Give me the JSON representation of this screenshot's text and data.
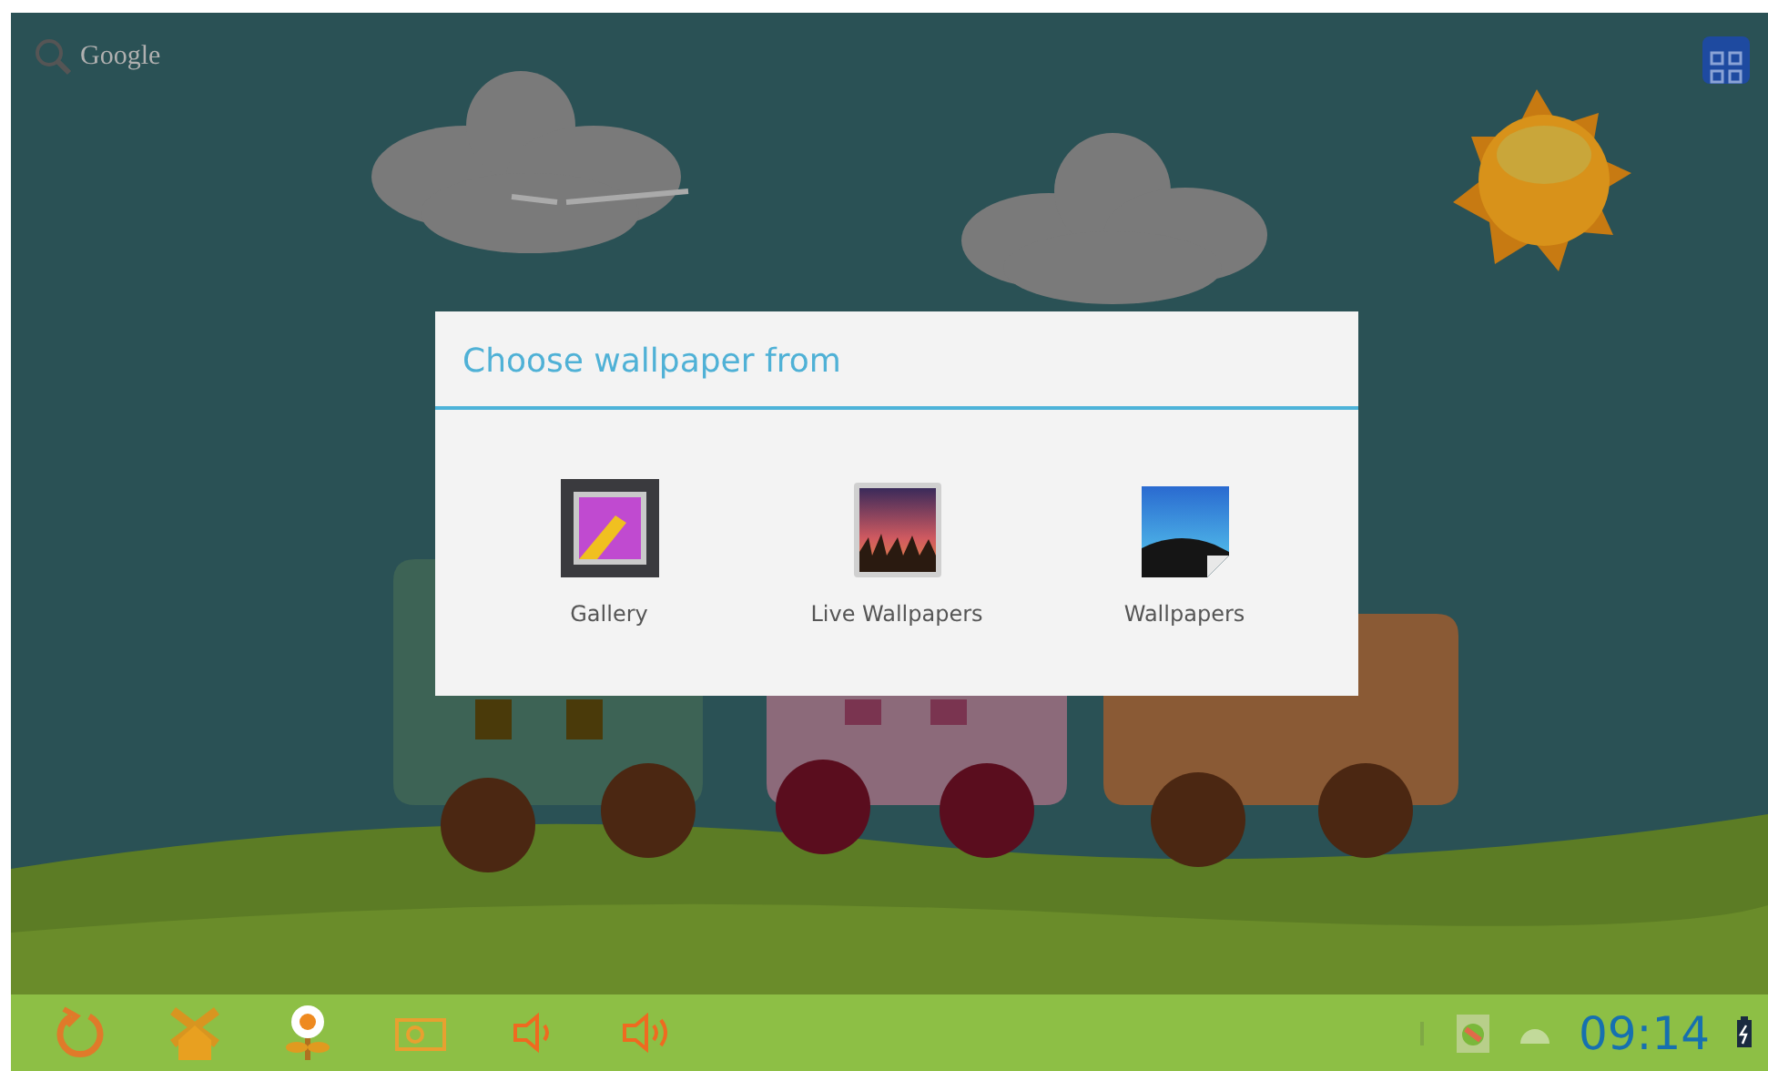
{
  "search": {
    "label": "Google"
  },
  "dialog": {
    "title": "Choose wallpaper from",
    "options": [
      {
        "label": "Gallery",
        "kind": "gallery"
      },
      {
        "label": "Live Wallpapers",
        "kind": "live"
      },
      {
        "label": "Wallpapers",
        "kind": "wallpapers"
      }
    ]
  },
  "status_bar": {
    "clock": "09:14"
  }
}
